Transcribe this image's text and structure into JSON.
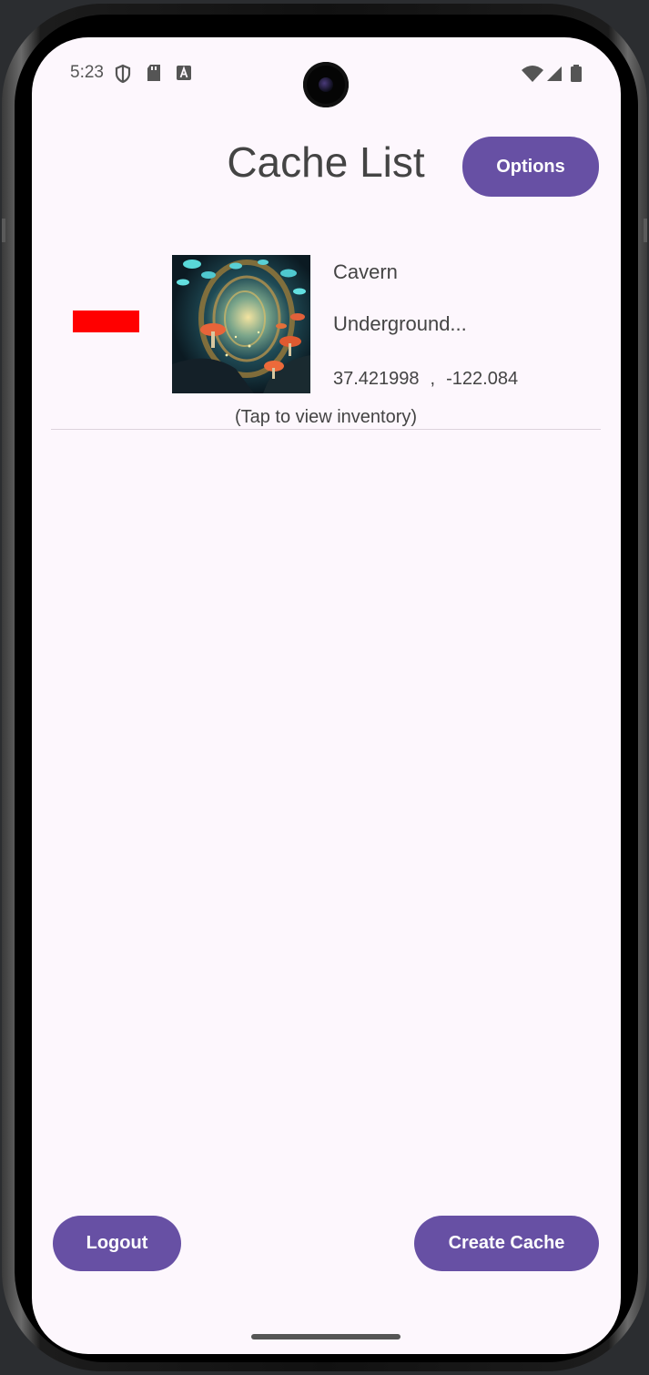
{
  "status_bar": {
    "time": "5:23",
    "left_icons": [
      "shield-icon",
      "sd-card-icon",
      "text-a-icon"
    ],
    "right_icons": [
      "wifi-icon",
      "cell-signal-icon",
      "battery-icon"
    ]
  },
  "header": {
    "title": "Cache List",
    "options_label": "Options"
  },
  "cache_list": {
    "items": [
      {
        "name": "Cavern",
        "description": "Underground...",
        "latitude": "37.421998",
        "separator": ",",
        "longitude": "-122.084",
        "hint": "(Tap to view inventory)",
        "marker_color": "#ff0000",
        "image_icon": "mushroom-cave-image"
      }
    ]
  },
  "footer": {
    "logout_label": "Logout",
    "create_label": "Create Cache"
  },
  "colors": {
    "accent": "#6750a4",
    "background": "#fdf7fd",
    "text": "#444444"
  }
}
